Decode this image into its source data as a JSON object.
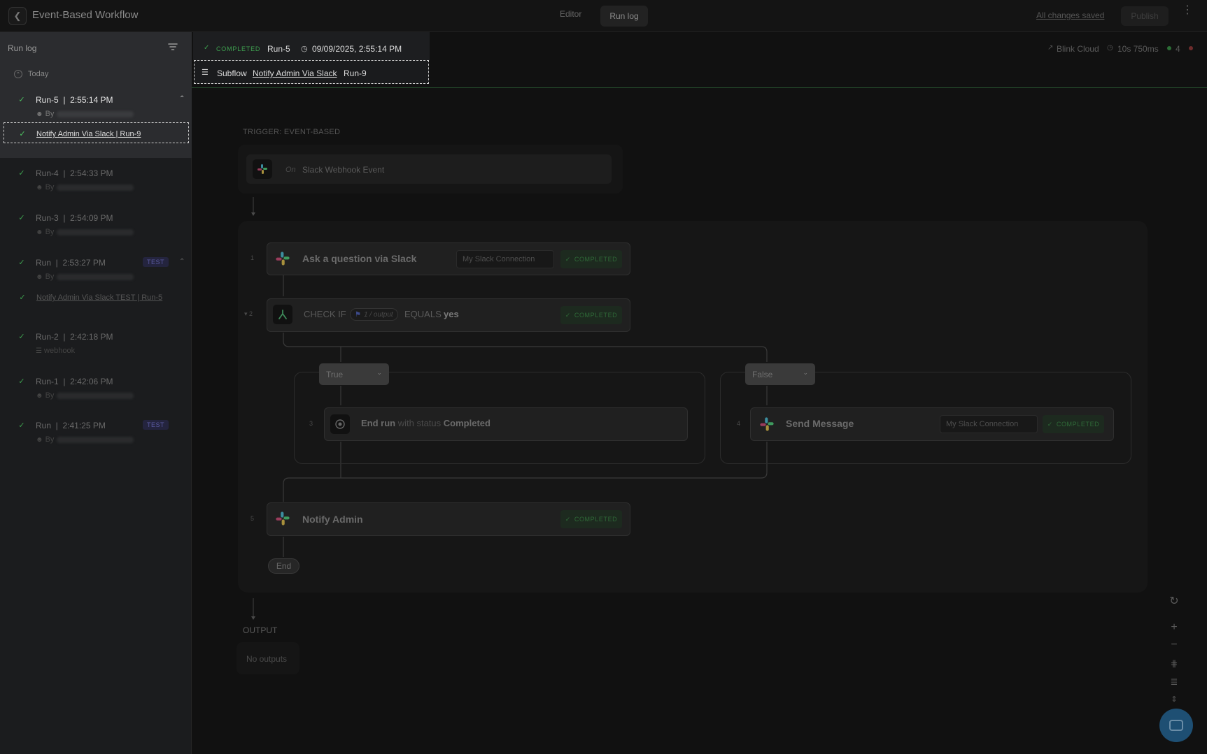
{
  "header": {
    "title": "Event-Based Workflow",
    "tabs": [
      "Editor",
      "Run log"
    ],
    "changes_saved": "All changes saved",
    "publish": "Publish"
  },
  "sidebar": {
    "title": "Run log",
    "group": "Today",
    "runs": [
      {
        "name": "Run-5",
        "time": "2:55:14 PM",
        "by": "By",
        "subflow": "Notify Admin Via Slack | Run-9"
      },
      {
        "name": "Run-4",
        "time": "2:54:33 PM",
        "by": "By"
      },
      {
        "name": "Run-3",
        "time": "2:54:09 PM",
        "by": "By"
      },
      {
        "name": "Run",
        "time": "2:53:27 PM",
        "by": "By",
        "badge": "TEST",
        "subflow": "Notify Admin Via Slack TEST | Run-5"
      },
      {
        "name": "Run-2",
        "time": "2:42:18 PM",
        "by": "webhook"
      },
      {
        "name": "Run-1",
        "time": "2:42:06 PM",
        "by": "By"
      },
      {
        "name": "Run",
        "time": "2:41:25 PM",
        "by": "By",
        "badge": "TEST"
      }
    ]
  },
  "run_header": {
    "status": "COMPLETED",
    "run": "Run-5",
    "datetime": "09/09/2025, 2:55:14 PM",
    "subflow_label": "Subflow",
    "subflow_link": "Notify Admin Via Slack",
    "subflow_run": "Run-9",
    "cloud": "Blink Cloud",
    "duration": "10s 750ms",
    "ok_count": "4",
    "ok_color": "#2c6e36",
    "err_color": "#6e2c2c"
  },
  "canvas": {
    "trigger_label": "TRIGGER: EVENT-BASED",
    "trigger_on": "On",
    "trigger_name": "Slack Webhook Event",
    "steps": {
      "s1": {
        "idx": "1",
        "title": "Ask a question via Slack",
        "connection": "My Slack Connection",
        "status": "COMPLETED"
      },
      "s2": {
        "idx": "2",
        "check": "CHECK IF",
        "var": "1 / output",
        "op": "EQUALS",
        "val": "yes",
        "status": "COMPLETED"
      },
      "s3": {
        "idx": "3",
        "title": "End run",
        "mid": "with status",
        "status_text": "Completed"
      },
      "s4": {
        "idx": "4",
        "title": "Send Message",
        "connection": "My Slack Connection",
        "status": "COMPLETED"
      },
      "s5": {
        "idx": "5",
        "title": "Notify Admin",
        "status": "COMPLETED"
      }
    },
    "branch_true": "True",
    "branch_false": "False",
    "end": "End",
    "output_label": "OUTPUT",
    "no_outputs": "No outputs"
  },
  "icons": {
    "back": "chevron-left-icon",
    "filter": "filter-icon",
    "slack": "slack-icon",
    "check": "check-icon",
    "clock": "clock-icon",
    "cloud": "cloud-icon",
    "chat": "chat-icon"
  }
}
